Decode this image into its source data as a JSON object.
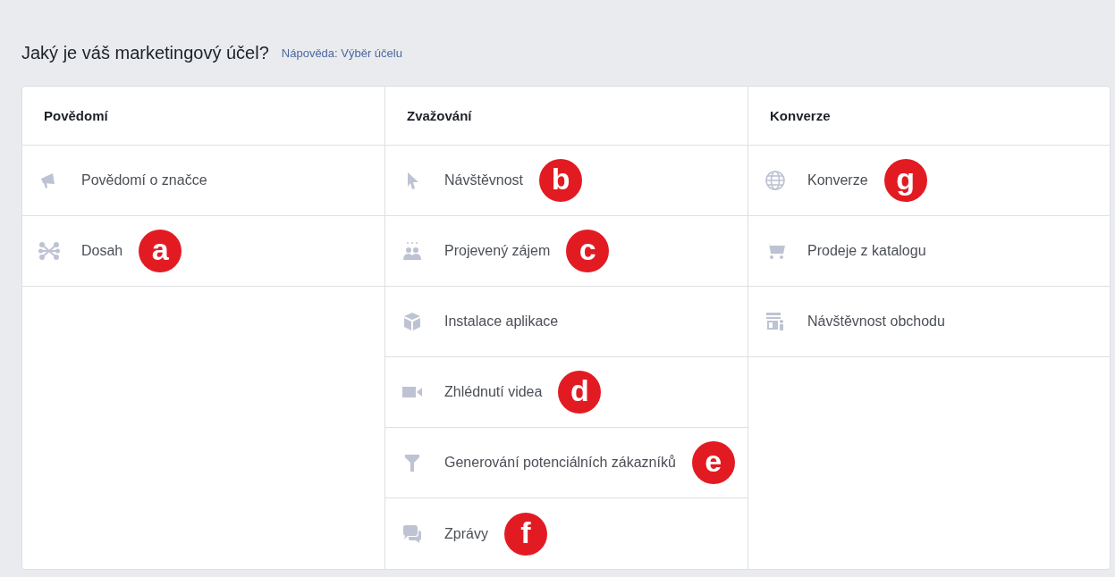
{
  "heading": "Jaký je váš marketingový účel?",
  "help_link": "Nápověda: Výběr účelu",
  "columns": [
    {
      "title": "Povědomí",
      "items": [
        {
          "kind": "megaphone",
          "label": "Povědomí o značce"
        },
        {
          "kind": "network",
          "label": "Dosah",
          "badge": "a"
        }
      ]
    },
    {
      "title": "Zvažování",
      "items": [
        {
          "kind": "pointer",
          "label": "Návštěvnost",
          "badge": "b"
        },
        {
          "kind": "people",
          "label": "Projevený zájem",
          "badge": "c"
        },
        {
          "kind": "cube",
          "label": "Instalace aplikace"
        },
        {
          "kind": "video",
          "label": "Zhlédnutí videa",
          "badge": "d"
        },
        {
          "kind": "funnel",
          "label": "Generování potenciálních zákazníků",
          "badge": "e"
        },
        {
          "kind": "chat",
          "label": "Zprávy",
          "badge": "f"
        }
      ]
    },
    {
      "title": "Konverze",
      "items": [
        {
          "kind": "globe",
          "label": "Konverze",
          "badge": "g"
        },
        {
          "kind": "cart",
          "label": "Prodeje z katalogu"
        },
        {
          "kind": "store",
          "label": "Návštěvnost obchodu"
        }
      ]
    }
  ]
}
